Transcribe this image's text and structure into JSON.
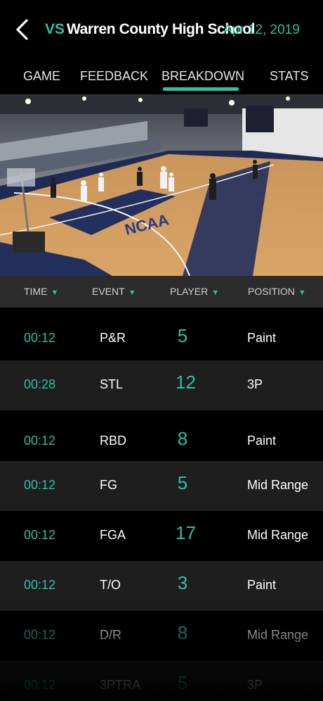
{
  "header": {
    "vs_label": "VS",
    "opponent": "Warren County High School",
    "date": "Apr 12, 2019",
    "back_icon": "chevron-left-icon"
  },
  "tabs": [
    {
      "label": "GAME",
      "active": false
    },
    {
      "label": "FEEDBACK",
      "active": false
    },
    {
      "label": "BREAKDOWN",
      "active": true
    },
    {
      "label": "STATS",
      "active": false
    }
  ],
  "columns": [
    {
      "label": "TIME",
      "sort_icon": "sort-down-triangle-icon"
    },
    {
      "label": "EVENT",
      "sort_icon": "sort-down-triangle-icon"
    },
    {
      "label": "PLAYER",
      "sort_icon": "sort-down-triangle-icon"
    },
    {
      "label": "POSITION",
      "sort_icon": "sort-down-triangle-icon"
    }
  ],
  "rows": [
    {
      "time": "00:12",
      "event": "P&R",
      "player": "5",
      "position": "Paint"
    },
    {
      "time": "00:28",
      "event": "STL",
      "player": "12",
      "position": "3P"
    },
    {
      "time": "00:12",
      "event": "RBD",
      "player": "8",
      "position": "Paint"
    },
    {
      "time": "00:12",
      "event": "FG",
      "player": "5",
      "position": "Mid Range"
    },
    {
      "time": "00:12",
      "event": "FGA",
      "player": "17",
      "position": "Mid Range"
    },
    {
      "time": "00:12",
      "event": "T/O",
      "player": "3",
      "position": "Paint"
    },
    {
      "time": "00:12",
      "event": "D/R",
      "player": "8",
      "position": "Mid Range"
    },
    {
      "time": "00:12",
      "event": "3PTRA",
      "player": "5",
      "position": "3P"
    }
  ],
  "colors": {
    "accent": "#2ebfa5",
    "background": "#000000",
    "row_alt": "#1e1e1e",
    "column_header_bg": "#2c2c2c"
  }
}
